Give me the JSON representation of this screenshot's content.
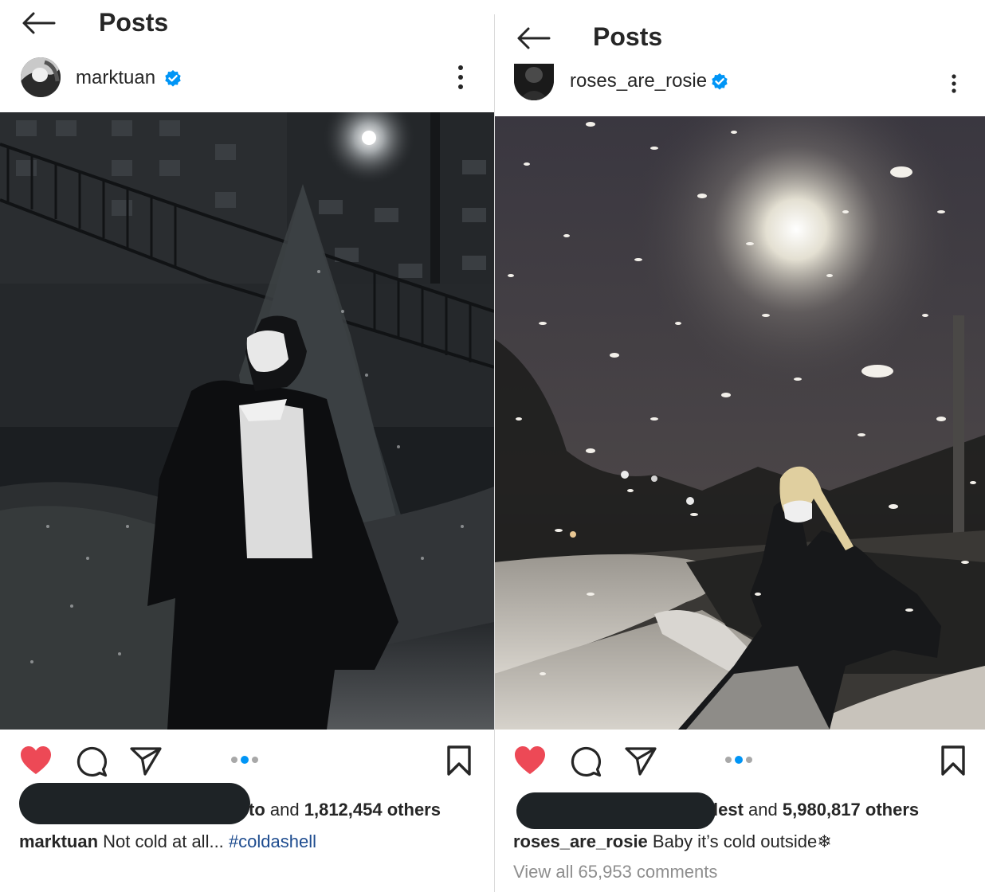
{
  "left_post": {
    "title": "Posts",
    "username": "marktuan",
    "likes": {
      "liked_by_fragment": "to",
      "and_text": "and",
      "count": "1,812,454",
      "others_text": "others"
    },
    "caption": {
      "user": "marktuan",
      "text": "Not cold at all...",
      "hashtag": "#coldashell"
    }
  },
  "right_post": {
    "title": "Posts",
    "username": "roses_are_rosie",
    "likes": {
      "liked_by_fragment": "lest",
      "and_text": "and",
      "count": "5,980,817",
      "others_text": "others"
    },
    "caption": {
      "user": "roses_are_rosie",
      "text": "Baby it’s cold outside❄"
    },
    "view_comments": "View all 65,953 comments"
  },
  "icons": [
    "back-arrow-icon",
    "verified-badge-icon",
    "more-options-icon",
    "heart-icon",
    "comment-icon",
    "share-icon",
    "save-bookmark-icon"
  ],
  "colors": {
    "like_red": "#ed4956",
    "verified_blue": "#0095f6",
    "hashtag_blue": "#1e4c8f",
    "muted_gray": "#8e8e8e",
    "redaction": "#1e2326"
  },
  "carousel": {
    "total": 3,
    "active_index": 1
  }
}
